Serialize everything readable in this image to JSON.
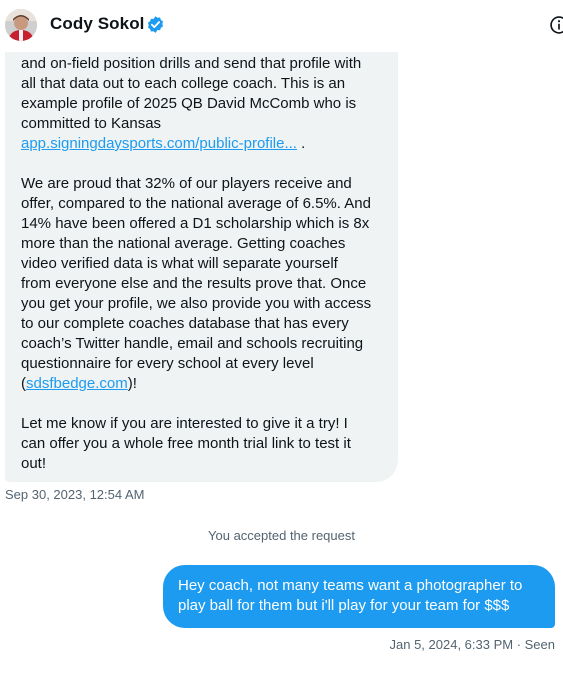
{
  "header": {
    "name": "Cody Sokol",
    "avatar_icon": "user-avatar",
    "verified_icon": "verified-badge-icon",
    "info_icon": "info-icon",
    "accent_color": "#1d9bf0"
  },
  "incoming": {
    "lines_p1": [
      "and on-field position drills and send that profile with",
      "all that data out to each college coach. This is an",
      "example profile of 2025 QB David McComb who is",
      "committed to Kansas"
    ],
    "link_profile": "app.signingdaysports.com/public-profile...",
    "after_link": " .",
    "lines_p2": [
      "We are proud that 32% of our players receive and",
      "offer, compared to the national average of 6.5%. And",
      "14% have been offered a D1 scholarship which is 8x",
      "more than the national average. Getting coaches",
      "video verified data is what will separate yourself",
      "from everyone else and the results prove that. Once",
      "you get your profile, we also provide you with access",
      "to our complete coaches database that has every",
      "coach’s Twitter handle, email and schools recruiting",
      "questionnaire for every school at every level"
    ],
    "paren_open": "(",
    "link_site": "sdsfbedge.com",
    "paren_close": ")!",
    "lines_p3": [
      "Let me know if you are interested to give it a try! I",
      "can offer you a whole free month trial link to test it",
      "out!"
    ],
    "timestamp": "Sep 30, 2023, 12:54 AM"
  },
  "system": {
    "text": "You accepted the request"
  },
  "outgoing": {
    "lines": [
      "Hey coach, not many teams want a photographer to",
      "play ball for them but i'll play for your team for $$$"
    ],
    "timestamp": "Jan 5, 2024, 6:33 PM · Seen"
  }
}
